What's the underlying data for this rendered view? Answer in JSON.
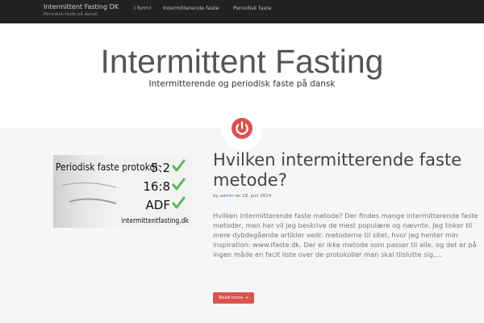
{
  "header": {
    "brand": "Intermittent Fasting DK",
    "tagline": "Periodisk faste på dansk",
    "nav": [
      "I form!",
      "Intermitterende faste",
      "Periodisk faste"
    ]
  },
  "hero": {
    "title": "Intermittent Fasting",
    "subtitle": "Intermitterende og periodisk faste på dansk"
  },
  "post": {
    "title": "Hvilken intermitterende faste metode?",
    "meta_prefix": "by",
    "author": "admin",
    "meta_mid": "on",
    "date": "18. juni 2014",
    "excerpt": "Hvilken intermitterende faste metode? Der findes mange intermitterende faste metoder, men her vil jeg beskrive de mest populære og nævnte. Jeg linker til mere dybdegående artikler vedr. metoderne til sitet, hvor jeg henter min inspiration: www.ifaste.dk. Der er ikke metode som passer til alle, og det er på ingen måde en facit liste over de protokoller man skal tilslutte sig….",
    "read_more": "Read more →",
    "image": {
      "heading": "Periodisk faste protokol:",
      "items": [
        "5:2",
        "16:8",
        "ADF"
      ],
      "site": "intermittentfasting.dk"
    }
  },
  "icons": {
    "power": "power-icon",
    "check": "checkmark-icon"
  },
  "colors": {
    "topbar": "#222222",
    "accent": "#d9534f",
    "check": "#5cb85c",
    "link": "#3a7dc5",
    "page_bg": "#f6f6f6"
  }
}
